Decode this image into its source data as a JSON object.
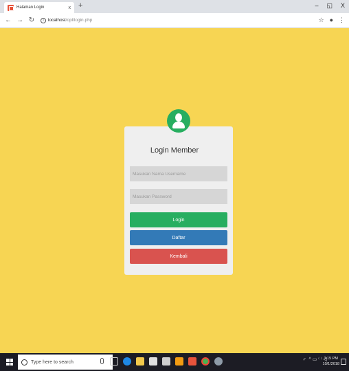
{
  "browser": {
    "tab_title": "Halaman Login",
    "tab_close": "x",
    "new_tab": "+",
    "controls": {
      "minimize": "–",
      "restore": "◱",
      "close": "X"
    },
    "url_host": "localhost",
    "url_path": "/opl/login.php",
    "info": "i",
    "star": "☆",
    "profile": "●",
    "menu": "⋮"
  },
  "login": {
    "title": "Login Member",
    "username_placeholder": "Masukan Nama Username",
    "password_placeholder": "Masukan Password",
    "login_label": "Login",
    "daftar_label": "Daftar",
    "kembali_label": "Kembali"
  },
  "taskbar": {
    "search_placeholder": "Type here to search",
    "time": "3:15 PM",
    "date": "10/1/2018",
    "tray_text": "^ ▭ ⁽ ⁾ ◁"
  },
  "colors": {
    "background": "#f7d553",
    "login_button": "#27ae60",
    "daftar_button": "#337ab7",
    "kembali_button": "#d9534f"
  }
}
